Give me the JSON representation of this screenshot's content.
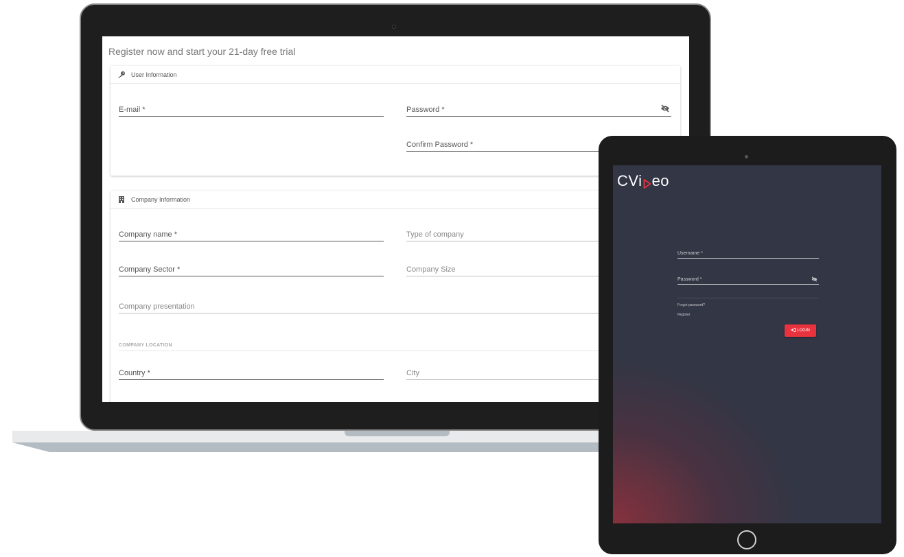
{
  "register_form": {
    "title": "Register now and start your 21-day free trial",
    "user_info": {
      "header": "User Information",
      "email_label": "E-mail *",
      "password_label": "Password *",
      "confirm_password_label": "Confirm Password *"
    },
    "company_info": {
      "header": "Company Information",
      "company_name_label": "Company name *",
      "type_label": "Type of company",
      "sector_label": "Company Sector *",
      "size_label": "Company Size",
      "presentation_label": "Company presentation",
      "location_section": "COMPANY LOCATION",
      "country_label": "Country *",
      "city_label": "City"
    }
  },
  "login": {
    "logo_left": "CVi",
    "logo_right": "eo",
    "username_label": "Username *",
    "password_label": "Password *",
    "forgot_link": "Forgot password?",
    "register_link": "Register",
    "login_button": "LOGIN"
  },
  "colors": {
    "accent": "#e8333f",
    "tablet_bg": "#323645",
    "device_frame": "#1e1e1e"
  },
  "icons": [
    "key-icon",
    "building-icon",
    "eye-off-icon",
    "login-icon",
    "play-icon"
  ]
}
